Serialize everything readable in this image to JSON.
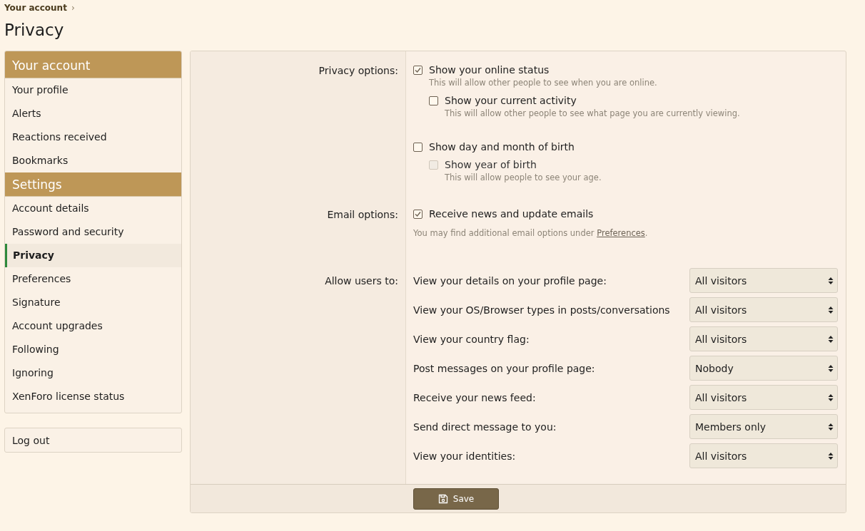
{
  "breadcrumb": {
    "label": "Your account",
    "separator": "›"
  },
  "title": "Privacy",
  "sidebar": {
    "sections": [
      {
        "heading": "Your account",
        "items": [
          {
            "label": "Your profile",
            "selected": false
          },
          {
            "label": "Alerts",
            "selected": false
          },
          {
            "label": "Reactions received",
            "selected": false
          },
          {
            "label": "Bookmarks",
            "selected": false
          }
        ]
      },
      {
        "heading": "Settings",
        "items": [
          {
            "label": "Account details",
            "selected": false
          },
          {
            "label": "Password and security",
            "selected": false
          },
          {
            "label": "Privacy",
            "selected": true
          },
          {
            "label": "Preferences",
            "selected": false
          },
          {
            "label": "Signature",
            "selected": false
          },
          {
            "label": "Account upgrades",
            "selected": false
          },
          {
            "label": "Following",
            "selected": false
          },
          {
            "label": "Ignoring",
            "selected": false
          },
          {
            "label": "XenForo license status",
            "selected": false
          }
        ]
      }
    ],
    "logout": "Log out"
  },
  "form": {
    "privacy": {
      "label": "Privacy options:",
      "groups": [
        {
          "label": "Show your online status",
          "checked": true,
          "disabled": false,
          "hint": "This will allow other people to see when you are online.",
          "children": [
            {
              "label": "Show your current activity",
              "checked": false,
              "disabled": false,
              "hint": "This will allow other people to see what page you are currently viewing."
            }
          ]
        },
        {
          "label": "Show day and month of birth",
          "checked": false,
          "disabled": false,
          "children": [
            {
              "label": "Show year of birth",
              "checked": false,
              "disabled": true,
              "hint": "This will allow people to see your age."
            }
          ]
        }
      ]
    },
    "email": {
      "label": "Email options:",
      "option": {
        "label": "Receive news and update emails",
        "checked": true,
        "disabled": false
      },
      "note": {
        "before": "You may find additional email options under ",
        "link": "Preferences",
        "after": "."
      }
    },
    "allow": {
      "label": "Allow users to:",
      "rows": [
        {
          "label": "View your details on your profile page:",
          "value": "All visitors"
        },
        {
          "label": "View your OS/Browser types in posts/conversations",
          "value": "All visitors"
        },
        {
          "label": "View your country flag:",
          "value": "All visitors"
        },
        {
          "label": "Post messages on your profile page:",
          "value": "Nobody"
        },
        {
          "label": "Receive your news feed:",
          "value": "All visitors"
        },
        {
          "label": "Send direct message to you:",
          "value": "Members only"
        },
        {
          "label": "View your identities:",
          "value": "All visitors"
        }
      ]
    },
    "save": "Save"
  }
}
